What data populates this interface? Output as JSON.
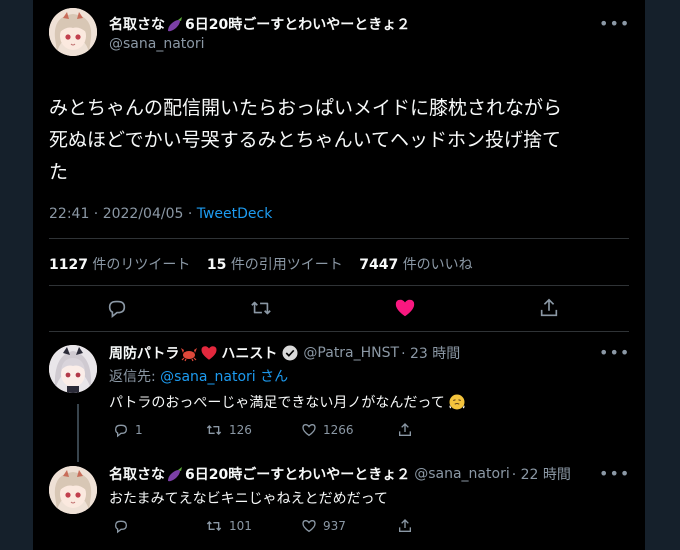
{
  "main_tweet": {
    "author_name": "名取さな",
    "author_name_suffix": "6日20時ごーすとわいやーときょ２",
    "author_handle": "@sana_natori",
    "text_line1": "みとちゃんの配信開いたらおっぱいメイドに膝枕されながら",
    "text_line2": "死ぬほどでかい号哭するみとちゃんいてヘッドホン投げ捨て",
    "text_line3": "た",
    "time": "22:41 · 2022/04/05 · ",
    "source": "TweetDeck",
    "retweets_count": "1127",
    "retweets_label": "件のリツイート",
    "quotes_count": "15",
    "quotes_label": "件の引用ツイート",
    "likes_count": "7447",
    "likes_label": "件のいいね"
  },
  "reply1": {
    "author_name": "周防パトラ",
    "author_name_suffix": "ハニスト",
    "author_handle": "@Patra_HNST",
    "time": "· 23 時間",
    "reply_to_label": "返信先: ",
    "reply_to_handle": "@sana_natori",
    "reply_to_suffix": " さん",
    "text": "パトラのおっぺーじゃ満足できない月ノがなんだって",
    "reply_count": "1",
    "retweet_count": "126",
    "like_count": "1266"
  },
  "reply2": {
    "author_name": "名取さな",
    "author_name_suffix": "6日20時ごーすとわいやーときょ２",
    "author_handle": "@sana_natori",
    "time": "· 22 時間",
    "text": "おたまみてえなビキニじゃねえとだめだって",
    "reply_count": "",
    "retweet_count": "101",
    "like_count": "937"
  },
  "colors": {
    "background": "#000000",
    "text": "#f7f9f9",
    "secondary": "#8b98a5",
    "link": "#1d9bf0",
    "like_active": "#f91880",
    "border": "#2f3336"
  },
  "icons": [
    "more-icon",
    "eggplant-icon",
    "reply-icon",
    "retweet-icon",
    "heart-icon",
    "share-icon",
    "crab-icon",
    "red-heart-icon",
    "verified-icon",
    "puffing-face-icon"
  ]
}
